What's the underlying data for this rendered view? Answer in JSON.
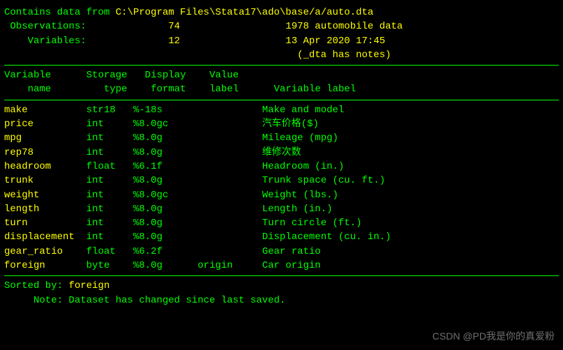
{
  "header": {
    "contains_prefix": "Contains data from ",
    "filepath": "C:\\Program Files\\Stata17\\ado\\base/a/auto.dta",
    "obs_label": " Observations:",
    "obs_value": "74",
    "dataset_label": "1978 automobile data",
    "vars_label": "    Variables:",
    "vars_value": "12",
    "timestamp": "13 Apr 2020 17:45",
    "notes": "(_dta has notes)"
  },
  "columns": {
    "c1a": "Variable",
    "c1b": "    name",
    "c2a": "Storage",
    "c2b": "   type",
    "c3a": "Display",
    "c3b": " format",
    "c4a": "Value",
    "c4b": "label",
    "c5a": "",
    "c5b": "Variable label"
  },
  "vars": [
    {
      "name": "make",
      "type": "str18",
      "fmt": "%-18s",
      "vlab": "",
      "label": "Make and model"
    },
    {
      "name": "price",
      "type": "int",
      "fmt": "%8.0gc",
      "vlab": "",
      "label": "汽车价格($)"
    },
    {
      "name": "mpg",
      "type": "int",
      "fmt": "%8.0g",
      "vlab": "",
      "label": "Mileage (mpg)"
    },
    {
      "name": "rep78",
      "type": "int",
      "fmt": "%8.0g",
      "vlab": "",
      "label": "维修次数"
    },
    {
      "name": "headroom",
      "type": "float",
      "fmt": "%6.1f",
      "vlab": "",
      "label": "Headroom (in.)"
    },
    {
      "name": "trunk",
      "type": "int",
      "fmt": "%8.0g",
      "vlab": "",
      "label": "Trunk space (cu. ft.)"
    },
    {
      "name": "weight",
      "type": "int",
      "fmt": "%8.0gc",
      "vlab": "",
      "label": "Weight (lbs.)"
    },
    {
      "name": "length",
      "type": "int",
      "fmt": "%8.0g",
      "vlab": "",
      "label": "Length (in.)"
    },
    {
      "name": "turn",
      "type": "int",
      "fmt": "%8.0g",
      "vlab": "",
      "label": "Turn circle (ft.)"
    },
    {
      "name": "displacement",
      "type": "int",
      "fmt": "%8.0g",
      "vlab": "",
      "label": "Displacement (cu. in.)"
    },
    {
      "name": "gear_ratio",
      "type": "float",
      "fmt": "%6.2f",
      "vlab": "",
      "label": "Gear ratio"
    },
    {
      "name": "foreign",
      "type": "byte",
      "fmt": "%8.0g",
      "vlab": "origin",
      "label": "Car origin"
    }
  ],
  "footer": {
    "sorted_label": "Sorted by: ",
    "sorted_value": "foreign",
    "note": "     Note: Dataset has changed since last saved."
  },
  "watermark": "CSDN @PD我是你的真爱粉"
}
